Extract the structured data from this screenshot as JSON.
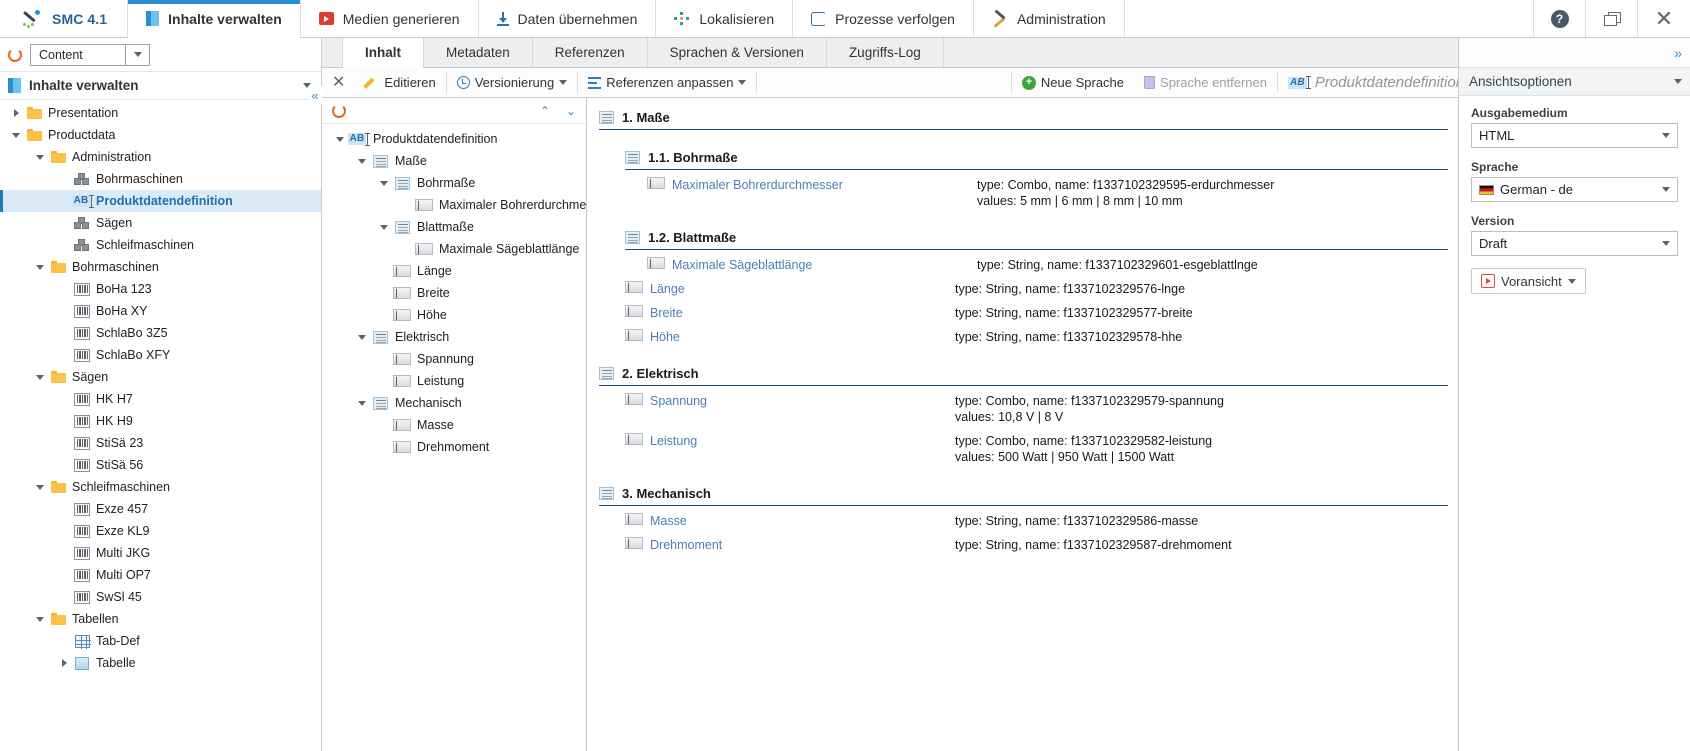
{
  "app": {
    "brand": "SMC 4.1",
    "nav": [
      {
        "label": "Inhalte verwalten",
        "icon": "content-icon",
        "active": true
      },
      {
        "label": "Medien generieren",
        "icon": "media-icon",
        "active": false
      },
      {
        "label": "Daten übernehmen",
        "icon": "download-icon",
        "active": false
      },
      {
        "label": "Lokalisieren",
        "icon": "localize-icon",
        "active": false
      },
      {
        "label": "Prozesse verfolgen",
        "icon": "process-icon",
        "active": false
      },
      {
        "label": "Administration",
        "icon": "admin-icon",
        "active": false
      }
    ],
    "window_buttons": [
      {
        "name": "help-button",
        "glyph": "?"
      },
      {
        "name": "restore-window-button",
        "glyph": "❐"
      },
      {
        "name": "close-window-button",
        "glyph": "✕"
      }
    ]
  },
  "left_panel": {
    "repository_select": {
      "value": "Content"
    },
    "refresh_label": "",
    "title": "Inhalte verwalten",
    "tree": [
      {
        "label": "Presentation",
        "depth": 1,
        "icon": "folder-icon",
        "twist": "collapsed",
        "selected": false
      },
      {
        "label": "Productdata",
        "depth": 1,
        "icon": "folder-icon",
        "twist": "expanded",
        "selected": false
      },
      {
        "label": "Administration",
        "depth": 2,
        "icon": "folder-icon",
        "twist": "expanded",
        "selected": false
      },
      {
        "label": "Bohrmaschinen",
        "depth": 3,
        "icon": "cube-icon",
        "twist": "none",
        "selected": false
      },
      {
        "label": "Produktdatendefinition",
        "depth": 3,
        "icon": "ab-icon",
        "twist": "none",
        "selected": true
      },
      {
        "label": "Sägen",
        "depth": 3,
        "icon": "cube-icon",
        "twist": "none",
        "selected": false
      },
      {
        "label": "Schleifmaschinen",
        "depth": 3,
        "icon": "cube-icon",
        "twist": "none",
        "selected": false
      },
      {
        "label": "Bohrmaschinen",
        "depth": 2,
        "icon": "folder-icon",
        "twist": "expanded",
        "selected": false
      },
      {
        "label": "BoHa 123",
        "depth": 3,
        "icon": "barcode-icon",
        "twist": "none",
        "selected": false
      },
      {
        "label": "BoHa XY",
        "depth": 3,
        "icon": "barcode-icon",
        "twist": "none",
        "selected": false
      },
      {
        "label": "SchlaBo 3Z5",
        "depth": 3,
        "icon": "barcode-icon",
        "twist": "none",
        "selected": false
      },
      {
        "label": "SchlaBo XFY",
        "depth": 3,
        "icon": "barcode-icon",
        "twist": "none",
        "selected": false
      },
      {
        "label": "Sägen",
        "depth": 2,
        "icon": "folder-icon",
        "twist": "expanded",
        "selected": false
      },
      {
        "label": "HK H7",
        "depth": 3,
        "icon": "barcode-icon",
        "twist": "none",
        "selected": false
      },
      {
        "label": "HK H9",
        "depth": 3,
        "icon": "barcode-icon",
        "twist": "none",
        "selected": false
      },
      {
        "label": "StiSä 23",
        "depth": 3,
        "icon": "barcode-icon",
        "twist": "none",
        "selected": false
      },
      {
        "label": "StiSä 56",
        "depth": 3,
        "icon": "barcode-icon",
        "twist": "none",
        "selected": false
      },
      {
        "label": "Schleifmaschinen",
        "depth": 2,
        "icon": "folder-icon",
        "twist": "expanded",
        "selected": false
      },
      {
        "label": "Exze 457",
        "depth": 3,
        "icon": "barcode-icon",
        "twist": "none",
        "selected": false
      },
      {
        "label": "Exze KL9",
        "depth": 3,
        "icon": "barcode-icon",
        "twist": "none",
        "selected": false
      },
      {
        "label": "Multi JKG",
        "depth": 3,
        "icon": "barcode-icon",
        "twist": "none",
        "selected": false
      },
      {
        "label": "Multi OP7",
        "depth": 3,
        "icon": "barcode-icon",
        "twist": "none",
        "selected": false
      },
      {
        "label": "SwSl 45",
        "depth": 3,
        "icon": "barcode-icon",
        "twist": "none",
        "selected": false
      },
      {
        "label": "Tabellen",
        "depth": 2,
        "icon": "folder-icon",
        "twist": "expanded",
        "selected": false
      },
      {
        "label": "Tab-Def",
        "depth": 3,
        "icon": "table-def-icon",
        "twist": "none",
        "selected": false
      },
      {
        "label": "Tabelle",
        "depth": 3,
        "icon": "table-icon",
        "twist": "collapsed",
        "selected": false
      }
    ]
  },
  "center": {
    "tabs": [
      {
        "label": "Inhalt",
        "active": true
      },
      {
        "label": "Metadaten",
        "active": false
      },
      {
        "label": "Referenzen",
        "active": false
      },
      {
        "label": "Sprachen & Versionen",
        "active": false
      },
      {
        "label": "Zugriffs-Log",
        "active": false
      }
    ],
    "toolbar": {
      "close_label": "",
      "edit_label": "Editieren",
      "versioning_label": "Versionierung",
      "references_label": "Referenzen anpassen",
      "new_language_label": "Neue Sprache",
      "remove_language_label": "Sprache entfernen",
      "document_title": "Produktdatendefinition"
    },
    "structure_tree": [
      {
        "label": "Produktdatendefinition",
        "depth": 0,
        "icon": "ab-icon",
        "twist": "expanded"
      },
      {
        "label": "Maße",
        "depth": 1,
        "icon": "list-icon",
        "twist": "expanded"
      },
      {
        "label": "Bohrmaße",
        "depth": 2,
        "icon": "list-icon",
        "twist": "expanded"
      },
      {
        "label": "Maximaler Bohrerdurchmesser",
        "depth": 3,
        "icon": "field-icon",
        "twist": "none"
      },
      {
        "label": "Blattmaße",
        "depth": 2,
        "icon": "list-icon",
        "twist": "expanded"
      },
      {
        "label": "Maximale Sägeblattlänge",
        "depth": 3,
        "icon": "field-icon",
        "twist": "none"
      },
      {
        "label": "Länge",
        "depth": 2,
        "icon": "field-icon",
        "twist": "none"
      },
      {
        "label": "Breite",
        "depth": 2,
        "icon": "field-icon",
        "twist": "none"
      },
      {
        "label": "Höhe",
        "depth": 2,
        "icon": "field-icon",
        "twist": "none"
      },
      {
        "label": "Elektrisch",
        "depth": 1,
        "icon": "list-icon",
        "twist": "expanded"
      },
      {
        "label": "Spannung",
        "depth": 2,
        "icon": "field-icon",
        "twist": "none"
      },
      {
        "label": "Leistung",
        "depth": 2,
        "icon": "field-icon",
        "twist": "none"
      },
      {
        "label": "Mechanisch",
        "depth": 1,
        "icon": "list-icon",
        "twist": "expanded"
      },
      {
        "label": "Masse",
        "depth": 2,
        "icon": "field-icon",
        "twist": "none"
      },
      {
        "label": "Drehmoment",
        "depth": 2,
        "icon": "field-icon",
        "twist": "none"
      }
    ],
    "form": [
      {
        "kind": "section",
        "level": 1,
        "label": "1. Maße"
      },
      {
        "kind": "section",
        "level": 2,
        "label": "1.1. Bohrmaße"
      },
      {
        "kind": "field",
        "indent": 2,
        "label": "Maximaler Bohrerdurchmesser",
        "meta": "type: Combo, name: f1337102329595-erdurchmesser",
        "meta2": "values: 5 mm | 6 mm | 8 mm | 10 mm"
      },
      {
        "kind": "section",
        "level": 2,
        "label": "1.2. Blattmaße"
      },
      {
        "kind": "field",
        "indent": 2,
        "label": "Maximale Sägeblattlänge",
        "meta": "type: String, name: f1337102329601-esgeblattlnge",
        "meta2": ""
      },
      {
        "kind": "field",
        "indent": 1,
        "label": "Länge",
        "meta": "type: String, name: f1337102329576-lnge",
        "meta2": ""
      },
      {
        "kind": "field",
        "indent": 1,
        "label": "Breite",
        "meta": "type: String, name: f1337102329577-breite",
        "meta2": ""
      },
      {
        "kind": "field",
        "indent": 1,
        "label": "Höhe",
        "meta": "type: String, name: f1337102329578-hhe",
        "meta2": ""
      },
      {
        "kind": "section",
        "level": 1,
        "label": "2. Elektrisch"
      },
      {
        "kind": "field",
        "indent": 1,
        "label": "Spannung",
        "meta": "type: Combo, name: f1337102329579-spannung",
        "meta2": "values: 10,8 V | 8 V"
      },
      {
        "kind": "field",
        "indent": 1,
        "label": "Leistung",
        "meta": "type: Combo, name: f1337102329582-leistung",
        "meta2": "values: 500 Watt | 950 Watt | 1500 Watt"
      },
      {
        "kind": "section",
        "level": 1,
        "label": "3. Mechanisch"
      },
      {
        "kind": "field",
        "indent": 1,
        "label": "Masse",
        "meta": "type: String, name: f1337102329586-masse",
        "meta2": ""
      },
      {
        "kind": "field",
        "indent": 1,
        "label": "Drehmoment",
        "meta": "type: String, name: f1337102329587-drehmoment",
        "meta2": ""
      }
    ]
  },
  "right_panel": {
    "header": "Ansichtsoptionen",
    "fields": [
      {
        "label": "Ausgabemedium",
        "value": "HTML",
        "flag": false
      },
      {
        "label": "Sprache",
        "value": "German - de",
        "flag": true
      },
      {
        "label": "Version",
        "value": "Draft",
        "flag": false
      }
    ],
    "preview_button": "Voransicht"
  },
  "colors": {
    "accent_blue": "#2a8fd0",
    "link_blue": "#4a7fb5",
    "section_rule": "#1f4f7a",
    "selection_bg": "#dbeaf7",
    "folder_yellow": "#fcc247",
    "green_add": "#3aa63a",
    "orange_refresh": "#e8661a"
  }
}
